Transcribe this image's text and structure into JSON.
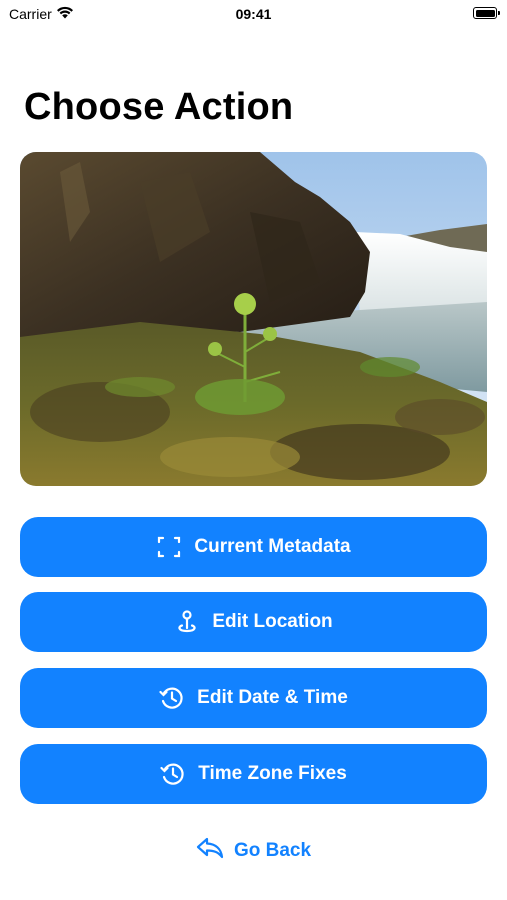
{
  "status_bar": {
    "carrier": "Carrier",
    "time": "09:41"
  },
  "page": {
    "title": "Choose Action"
  },
  "photo": {
    "description_icon": "landscape-photo"
  },
  "actions": [
    {
      "label": "Current Metadata",
      "icon": "viewfinder-icon"
    },
    {
      "label": "Edit Location",
      "icon": "map-pin-icon"
    },
    {
      "label": "Edit Date & Time",
      "icon": "clock-history-icon"
    },
    {
      "label": "Time Zone Fixes",
      "icon": "clock-rewind-icon"
    }
  ],
  "back": {
    "label": "Go Back",
    "icon": "back-arrow-icon"
  },
  "colors": {
    "accent": "#1282ff",
    "background": "#ffffff"
  }
}
